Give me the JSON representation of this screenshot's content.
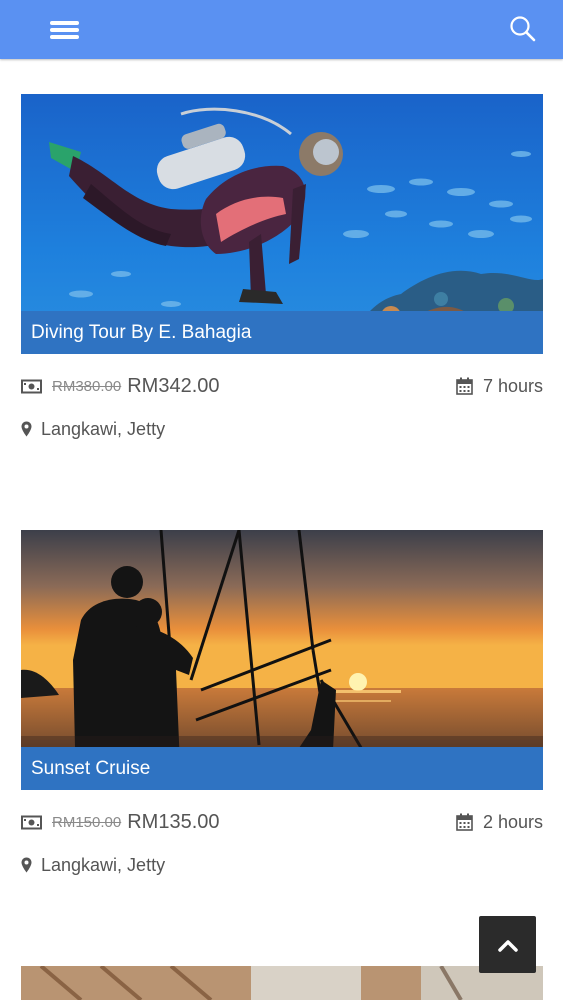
{
  "header": {
    "menu_icon": "hamburger-menu-icon",
    "search_icon": "search-icon",
    "bar_color": "#5a91f2"
  },
  "tours": [
    {
      "title": "Diving Tour By E. Bahagia",
      "old_price": "RM380.00",
      "price": "RM342.00",
      "duration": "7 hours",
      "location": "Langkawi, Jetty",
      "image": "scuba diver swimming over coral reef with fish"
    },
    {
      "title": "Sunset Cruise",
      "old_price": "RM150.00",
      "price": "RM135.00",
      "duration": "2 hours",
      "location": "Langkawi, Jetty",
      "image": "silhouetted couple on boat deck at sunset"
    }
  ],
  "colors": {
    "caption_bg": "#2f73c2",
    "text": "#555555",
    "old_price": "#8a8a8a",
    "back_to_top_bg": "#2b2b2b"
  },
  "back_to_top_icon": "chevron-up-icon"
}
